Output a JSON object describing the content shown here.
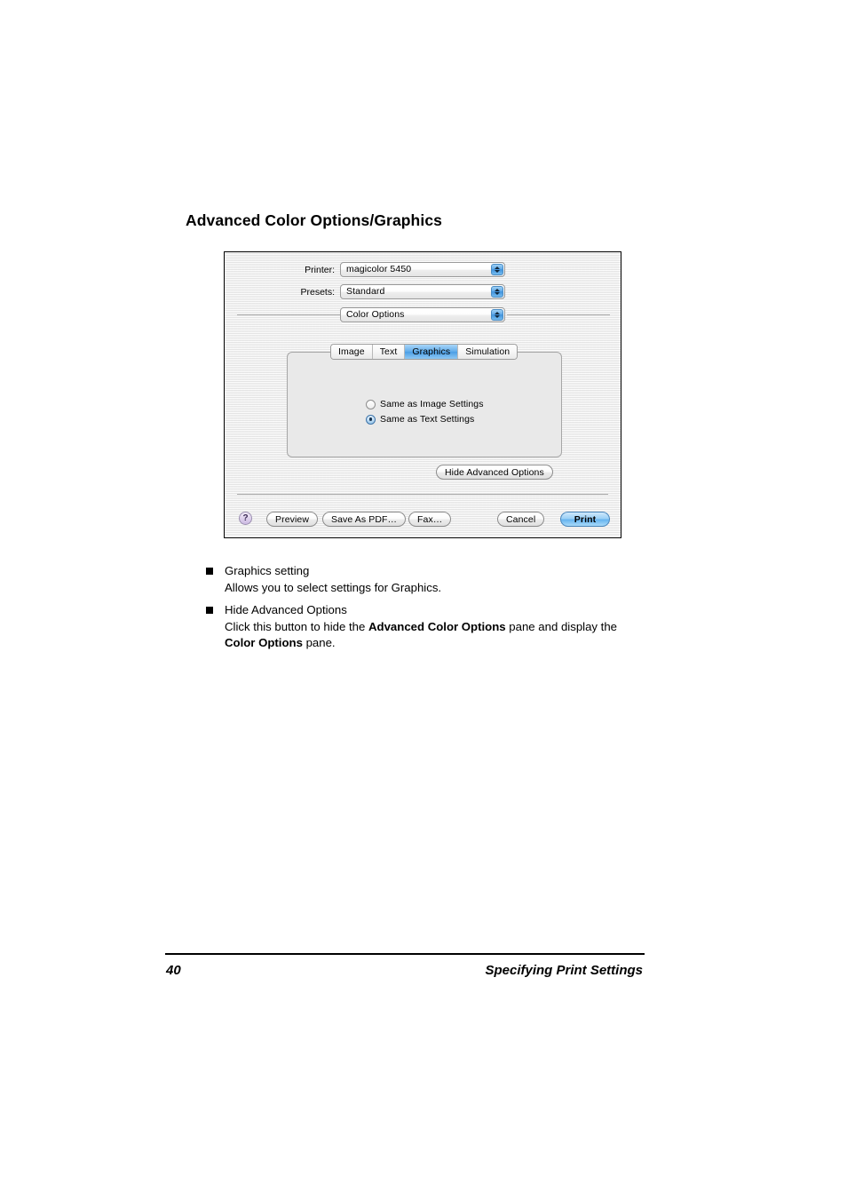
{
  "page": {
    "heading": "Advanced Color Options/Graphics"
  },
  "dialog": {
    "printer": {
      "label": "Printer:",
      "value": "magicolor 5450"
    },
    "presets": {
      "label": "Presets:",
      "value": "Standard"
    },
    "pane": {
      "value": "Color Options"
    },
    "tabs": [
      {
        "label": "Image",
        "selected": false
      },
      {
        "label": "Text",
        "selected": false
      },
      {
        "label": "Graphics",
        "selected": true
      },
      {
        "label": "Simulation",
        "selected": false
      }
    ],
    "radios": [
      {
        "label": "Same as Image Settings",
        "selected": false
      },
      {
        "label": "Same as Text Settings",
        "selected": true
      }
    ],
    "hide_advanced_label": "Hide Advanced Options",
    "help_label": "?",
    "buttons": {
      "preview": "Preview",
      "save_as_pdf": "Save As PDF…",
      "fax": "Fax…",
      "cancel": "Cancel",
      "print": "Print"
    },
    "colors": {
      "selected_tab": "#4b9ee5",
      "default_button": "#67b4ef",
      "help_button": "#cbb9e2"
    }
  },
  "bullets": [
    {
      "title": "Graphics setting",
      "body_parts": [
        {
          "text": "Allows you to select settings for Graphics.",
          "bold": false
        }
      ]
    },
    {
      "title": "Hide Advanced Options",
      "body_parts": [
        {
          "text": "Click this button to hide the ",
          "bold": false
        },
        {
          "text": "Advanced Color Options",
          "bold": true
        },
        {
          "text": " pane and display the ",
          "bold": false
        },
        {
          "text": "Color Options",
          "bold": true
        },
        {
          "text": " pane.",
          "bold": false
        }
      ]
    }
  ],
  "footer": {
    "page_number": "40",
    "section_title": "Specifying Print Settings"
  }
}
